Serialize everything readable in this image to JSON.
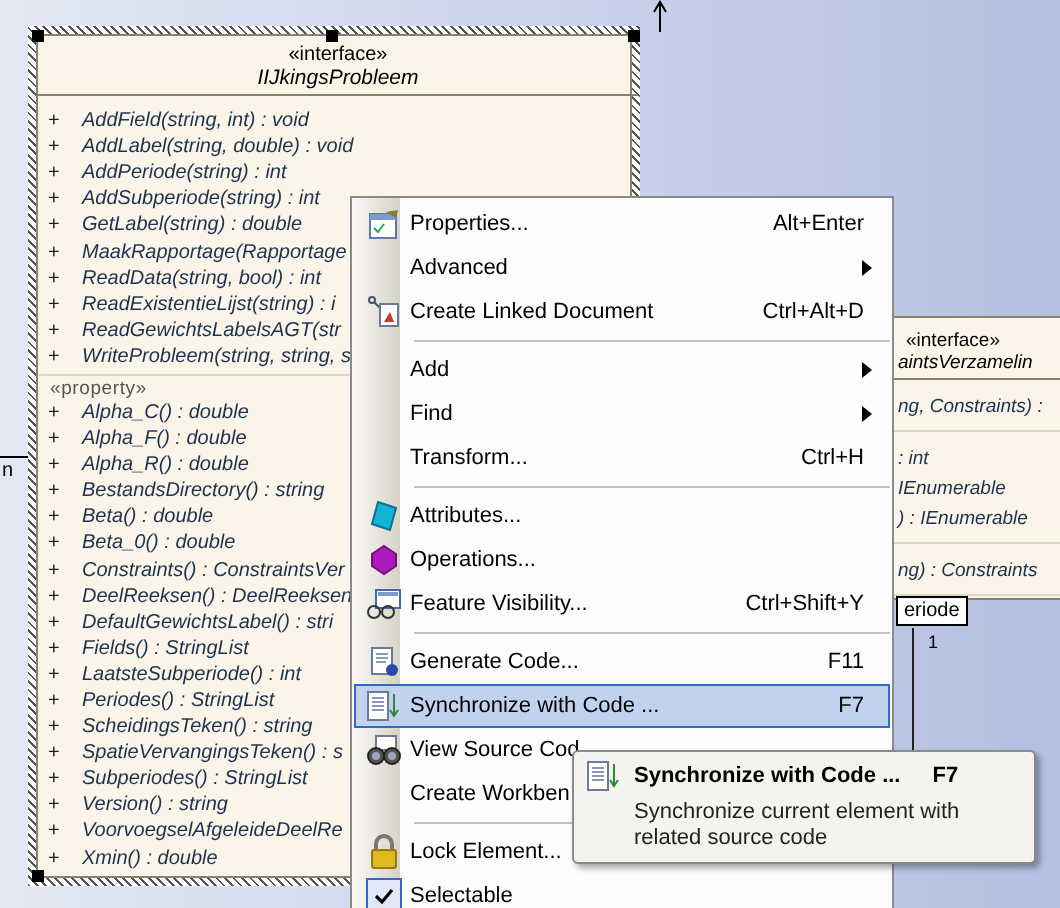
{
  "diagram": {
    "main_class": {
      "selected": true,
      "stereotype": "«interface»",
      "name": "IIJkingsProbleem",
      "sections": [
        {
          "items": [
            {
              "visibility": "+",
              "text": "AddField(string, int) : void"
            },
            {
              "visibility": "+",
              "text": "AddLabel(string, double) : void"
            },
            {
              "visibility": "+",
              "text": "AddPeriode(string) : int"
            },
            {
              "visibility": "+",
              "text": "AddSubperiode(string) : int"
            },
            {
              "visibility": "+",
              "text": "GetLabel(string) : double"
            },
            {
              "visibility": "+",
              "text": "MaakRapportage(Rapportage"
            },
            {
              "visibility": "+",
              "text": "ReadData(string, bool) : int"
            },
            {
              "visibility": "+",
              "text": "ReadExistentieLijst(string) : i"
            },
            {
              "visibility": "+",
              "text": "ReadGewichtsLabelsAGT(str"
            },
            {
              "visibility": "+",
              "text": "WriteProbleem(string, string, s"
            }
          ]
        },
        {
          "stereotype": "«property»",
          "items": [
            {
              "visibility": "+",
              "text": "Alpha_C() : double"
            },
            {
              "visibility": "+",
              "text": "Alpha_F() : double"
            },
            {
              "visibility": "+",
              "text": "Alpha_R() : double"
            },
            {
              "visibility": "+",
              "text": "BestandsDirectory() : string"
            },
            {
              "visibility": "+",
              "text": "Beta() : double"
            },
            {
              "visibility": "+",
              "text": "Beta_0() : double"
            },
            {
              "visibility": "+",
              "text": "Constraints() : ConstraintsVer"
            },
            {
              "visibility": "+",
              "text": "DeelReeksen() : DeelReeksen"
            },
            {
              "visibility": "+",
              "text": "DefaultGewichtsLabel() : stri"
            },
            {
              "visibility": "+",
              "text": "Fields() : StringList"
            },
            {
              "visibility": "+",
              "text": "LaatsteSubperiode() : int"
            },
            {
              "visibility": "+",
              "text": "Periodes() : StringList"
            },
            {
              "visibility": "+",
              "text": "ScheidingsTeken() : string"
            },
            {
              "visibility": "+",
              "text": "SpatieVervangingsTeken() : s"
            },
            {
              "visibility": "+",
              "text": "Subperiodes() : StringList"
            },
            {
              "visibility": "+",
              "text": "Version() : string"
            },
            {
              "visibility": "+",
              "text": "VoorvoegselAfgeleideDeelRe"
            },
            {
              "visibility": "+",
              "text": "Xmin() : double"
            }
          ]
        }
      ]
    },
    "side_class": {
      "stereotype": "«interface»",
      "name": "aintsVerzamelin",
      "sections": [
        {
          "items": [
            "ng, Constraints) :"
          ]
        },
        {
          "items": [
            ": int",
            "IEnumerable",
            ") : IEnumerable"
          ]
        },
        {
          "items": [
            "ng) : Constraints"
          ]
        }
      ]
    },
    "left_connector_label": "n",
    "role_label": "eriode",
    "multiplicity": "1"
  },
  "context_menu": {
    "items": [
      {
        "kind": "item",
        "label": "Properties...",
        "shortcut": "Alt+Enter",
        "submenu": false,
        "selected": false,
        "checked": false
      },
      {
        "kind": "item",
        "label": "Advanced",
        "submenu": true,
        "selected": false,
        "checked": false
      },
      {
        "kind": "item",
        "label": "Create Linked Document",
        "shortcut": "Ctrl+Alt+D",
        "submenu": false,
        "selected": false,
        "checked": false
      },
      {
        "kind": "separator"
      },
      {
        "kind": "item",
        "label": "Add",
        "submenu": true,
        "selected": false,
        "checked": false
      },
      {
        "kind": "item",
        "label": "Find",
        "submenu": true,
        "selected": false,
        "checked": false
      },
      {
        "kind": "item",
        "label": "Transform...",
        "shortcut": "Ctrl+H",
        "submenu": false,
        "selected": false,
        "checked": false
      },
      {
        "kind": "separator"
      },
      {
        "kind": "item",
        "label": "Attributes...",
        "submenu": false,
        "selected": false,
        "checked": false
      },
      {
        "kind": "item",
        "label": "Operations...",
        "submenu": false,
        "selected": false,
        "checked": false
      },
      {
        "kind": "item",
        "label": "Feature Visibility...",
        "shortcut": "Ctrl+Shift+Y",
        "submenu": false,
        "selected": false,
        "checked": false
      },
      {
        "kind": "separator"
      },
      {
        "kind": "item",
        "label": "Generate Code...",
        "shortcut": "F11",
        "submenu": false,
        "selected": false,
        "checked": false
      },
      {
        "kind": "item",
        "label": "Synchronize with Code ...",
        "shortcut": "F7",
        "submenu": false,
        "selected": true,
        "checked": false
      },
      {
        "kind": "item",
        "label": "View Source Cod",
        "selected": false,
        "checked": false
      },
      {
        "kind": "item",
        "label": "Create Workben",
        "selected": false,
        "checked": false
      },
      {
        "kind": "separator"
      },
      {
        "kind": "item",
        "label": "Lock Element...",
        "selected": false,
        "checked": false
      },
      {
        "kind": "item",
        "label": "Selectable",
        "submenu": false,
        "selected": false,
        "checked": true
      }
    ]
  },
  "tooltip": {
    "title": "Synchronize with Code ...",
    "shortcut": "F7",
    "description": "Synchronize current element with related source code"
  }
}
